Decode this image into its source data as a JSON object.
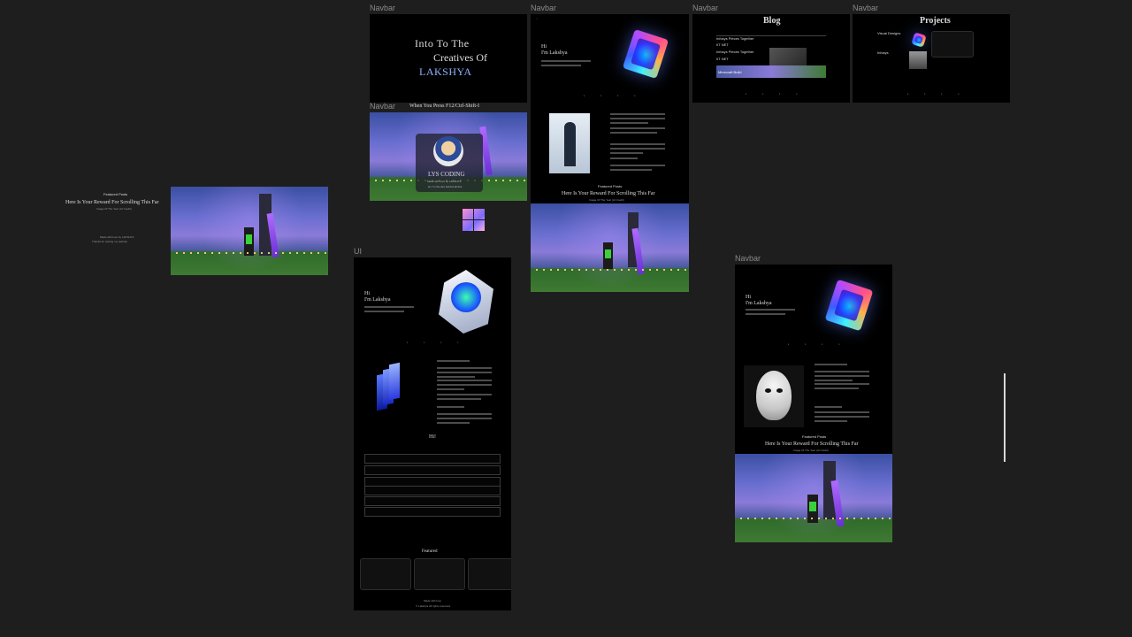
{
  "frames": {
    "navbar_1": "Navbar",
    "navbar_2": "Navbar",
    "navbar_3": "Navbar",
    "navbar_4": "Navbar",
    "navbar_5": "Navbar",
    "navbar_6": "Navbar",
    "ui": "UI"
  },
  "hero": {
    "line1": "Into To The",
    "line2": "Creatives Of",
    "name": "LAKSHYA"
  },
  "shortcut": {
    "title": "When You Press F12/Ctrl-Shift-I",
    "card_name": "LYS CODING",
    "card_sub": "Made with love by LAKSHYA",
    "card_sub2": "Hi, I'm the dev behind all this"
  },
  "intro": {
    "greeting": "Hi",
    "name_line": "I'm Lakshya"
  },
  "blog": {
    "title": "Blog",
    "items": [
      "Infosys Pieces Together",
      "IIT NET",
      "Infosys Pieces Together",
      "IIT NET",
      "Minecraft Build"
    ]
  },
  "projects": {
    "title": "Projects",
    "items": [
      "Visual Designs",
      "Infosys"
    ]
  },
  "reward": {
    "eyebrow": "Featured Posts",
    "title": "Here Is Your Reward For Scrolling This Far",
    "sub": "Image Of The Year (AI Credit)",
    "caption1": "Made with love by LAKSHYA",
    "caption2": "Thanks for visiting my website"
  },
  "ui_frame": {
    "greeting": "Hi",
    "name_line": "I'm Lakshya",
    "contact_label": "Hi!",
    "featured": "Featured",
    "footer1": "Made with love",
    "footer2": "© Lakshya All rights reserved"
  },
  "colors": {
    "canvas": "#1e1e1e",
    "frame": "#000000",
    "accent_blue": "#8fb4ff",
    "scrollbar": "#d8d8d8"
  }
}
